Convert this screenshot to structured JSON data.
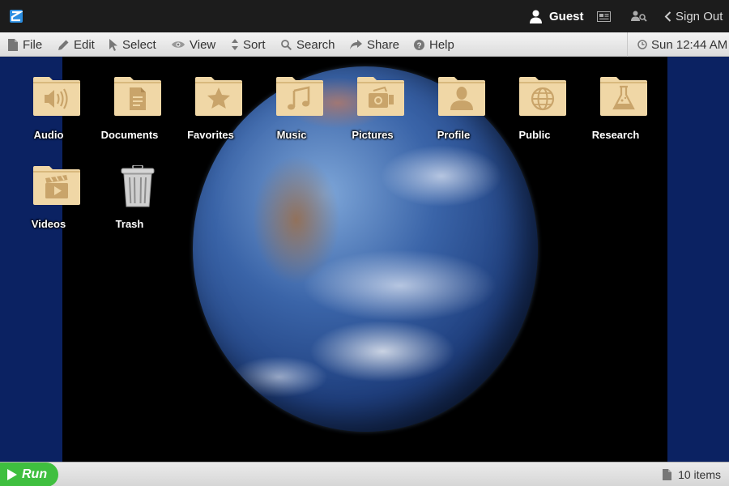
{
  "topbar": {
    "user_label": "Guest",
    "signout_label": "Sign Out",
    "icons": [
      "logo-icon",
      "user-icon",
      "newspaper-icon",
      "user-search-icon",
      "chevron-left-icon"
    ]
  },
  "menu": {
    "items": [
      {
        "label": "File",
        "icon": "file-icon"
      },
      {
        "label": "Edit",
        "icon": "pencil-icon"
      },
      {
        "label": "Select",
        "icon": "cursor-icon"
      },
      {
        "label": "View",
        "icon": "eye-icon"
      },
      {
        "label": "Sort",
        "icon": "sort-icon"
      },
      {
        "label": "Search",
        "icon": "search-icon"
      },
      {
        "label": "Share",
        "icon": "share-icon"
      },
      {
        "label": "Help",
        "icon": "help-icon"
      }
    ],
    "clock": "Sun 12:44 AM"
  },
  "desktop": {
    "icons": [
      {
        "label": "Audio",
        "icon": "audio-folder-icon"
      },
      {
        "label": "Documents",
        "icon": "documents-folder-icon"
      },
      {
        "label": "Favorites",
        "icon": "favorites-folder-icon"
      },
      {
        "label": "Music",
        "icon": "music-folder-icon"
      },
      {
        "label": "Pictures",
        "icon": "pictures-folder-icon"
      },
      {
        "label": "Profile",
        "icon": "profile-folder-icon"
      },
      {
        "label": "Public",
        "icon": "public-folder-icon"
      },
      {
        "label": "Research",
        "icon": "research-folder-icon"
      },
      {
        "label": "Videos",
        "icon": "videos-folder-icon"
      },
      {
        "label": "Trash",
        "icon": "trash-icon"
      }
    ]
  },
  "statusbar": {
    "run_label": "Run",
    "item_count": "10 items"
  },
  "colors": {
    "desktop_background": "#0b2262",
    "topbar_background": "#1c1c1c",
    "folder": "#f0d7a6",
    "run_button": "#3fbf3f"
  }
}
